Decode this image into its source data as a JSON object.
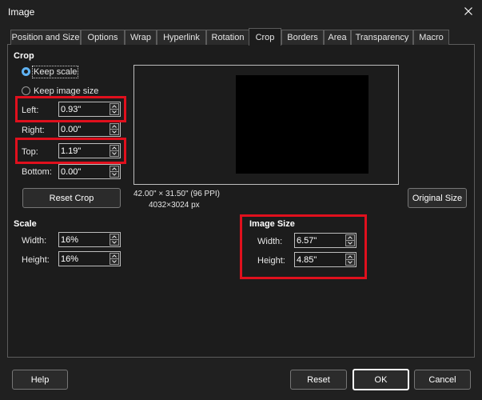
{
  "window": {
    "title": "Image"
  },
  "tabs": [
    {
      "label": "Position and Size"
    },
    {
      "label": "Options"
    },
    {
      "label": "Wrap"
    },
    {
      "label": "Hyperlink"
    },
    {
      "label": "Rotation"
    },
    {
      "label": "Crop",
      "active": true
    },
    {
      "label": "Borders"
    },
    {
      "label": "Area"
    },
    {
      "label": "Transparency"
    },
    {
      "label": "Macro"
    }
  ],
  "crop": {
    "heading": "Crop",
    "keep_scale_label": "Keep scale",
    "keep_image_size_label": "Keep image size",
    "selected_option": "Keep scale",
    "left": {
      "label": "Left:",
      "value": "0.93\""
    },
    "right": {
      "label": "Right:",
      "value": "0.00\""
    },
    "top": {
      "label": "Top:",
      "value": "1.19\""
    },
    "bottom": {
      "label": "Bottom:",
      "value": "0.00\""
    },
    "reset_button": "Reset Crop"
  },
  "scale": {
    "heading": "Scale",
    "width": {
      "label": "Width:",
      "value": "16%"
    },
    "height": {
      "label": "Height:",
      "value": "16%"
    }
  },
  "preview": {
    "size_info": "42.00\" × 31.50\" (96 PPI)",
    "pixel_info": "4032×3024 px",
    "original_size_button": "Original Size"
  },
  "image_size": {
    "heading": "Image Size",
    "width": {
      "label": "Width:",
      "value": "6.57\""
    },
    "height": {
      "label": "Height:",
      "value": "4.85\""
    }
  },
  "footer": {
    "help": "Help",
    "reset": "Reset",
    "ok": "OK",
    "cancel": "Cancel"
  },
  "colors": {
    "background": "#202020",
    "panel": "#1c1c1c",
    "accent": "#5fb2f2",
    "highlight": "#e0101d"
  },
  "icons": {
    "close": "close-icon",
    "spin_up": "chevron-up-icon",
    "spin_down": "chevron-down-icon"
  }
}
